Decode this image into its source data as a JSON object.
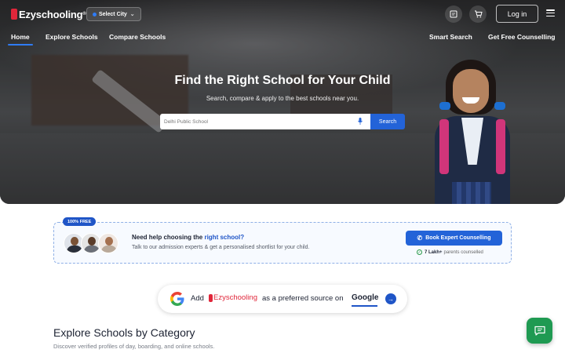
{
  "header": {
    "logo_text": "Ezyschooling",
    "logo_reg": "®",
    "city_label": "Select City",
    "login_label": "Log in",
    "icons": [
      "compare-list-icon",
      "cart-icon",
      "menu-icon"
    ]
  },
  "nav": {
    "items": [
      "Home",
      "Explore Schools",
      "Compare Schools"
    ],
    "right_items": [
      "Smart Search",
      "Get Free Counselling"
    ],
    "active": "Home"
  },
  "hero": {
    "title": "Find the Right School for Your Child",
    "subtitle": "Search, compare & apply to the best schools near you.",
    "search_placeholder": "Delhi Public School",
    "search_button": "Search"
  },
  "help_card": {
    "badge": "100% FREE",
    "title_prefix": "Need help choosing the ",
    "title_highlight": "right school?",
    "subtitle": "Talk to our admission experts & get a personalised shortlist for your child.",
    "cta": "Book Expert Counselling",
    "stat_value": "7 Lakh+",
    "stat_label": "parents counselled"
  },
  "google_pill": {
    "add_text": "Add",
    "brand": "Ezyschooling",
    "rest": "as a preferred source on",
    "google": "Google"
  },
  "category_section": {
    "title": "Explore Schools by Category",
    "subtitle": "Discover verified profiles of day, boarding, and online schools."
  },
  "colors": {
    "brand_red": "#e0263a",
    "primary_blue": "#2363d8",
    "chat_green": "#1f9a52"
  }
}
